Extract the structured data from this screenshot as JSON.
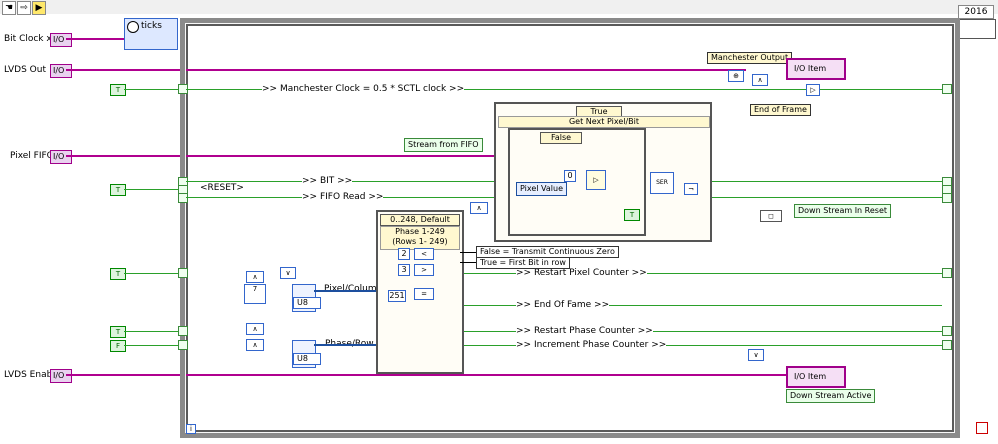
{
  "toolbar": {
    "icons": [
      "hand-icon",
      "pointer-icon",
      "run-arrow-icon"
    ],
    "year": "2016"
  },
  "left_terminals": {
    "bit_clock": "Bit Clock x2",
    "lvds_out": "LVDS Out",
    "pixel_fifo": "Pixel FIFO",
    "lvds_enable": "LVDS Enable"
  },
  "loop": {
    "ticks": "ticks"
  },
  "labels": {
    "manchester_clock": ">> Manchester Clock = 0.5 * SCTL clock >>",
    "manchester_output": "Manchester Output",
    "end_of_frame": "End of Frame",
    "reset": "<RESET>",
    "bit": ">> BIT >>",
    "fifo_read": ">> FIFO Read >>",
    "stream_from_fifo": "Stream from FIFO",
    "pixel_value": "Pixel Value",
    "get_next": "Get Next Pixel/Bit",
    "case_true": "True",
    "case_false": "False",
    "case_phase": "0..248, Default",
    "phase_title": "Phase 1-249\n(Rows 1- 249)",
    "pixel_column": "Pixel/Column",
    "phase_row": "Phase/Row",
    "false_transmit": "False = Transmit Continuous Zero",
    "true_first": "True = First Bit in row",
    "restart_pixel": ">> Restart Pixel Counter >>",
    "end_of_fame": ">> End Of Fame >>",
    "restart_phase": ">> Restart Phase Counter >>",
    "increment_phase": ">> Increment Phase Counter >>",
    "down_stream_reset": "Down Stream In Reset",
    "down_stream_active": "Down Stream Active",
    "io_item": "I/O Item",
    "u8": "U8",
    "const_2": "2",
    "const_3": "3",
    "const_251": "251",
    "const_0": "0",
    "const_7": "7"
  },
  "colors": {
    "fpga_io": "#a0008a",
    "bool": "#2a8a2a",
    "numeric": "#1d4f9e",
    "frame": "#8a8a8a"
  }
}
